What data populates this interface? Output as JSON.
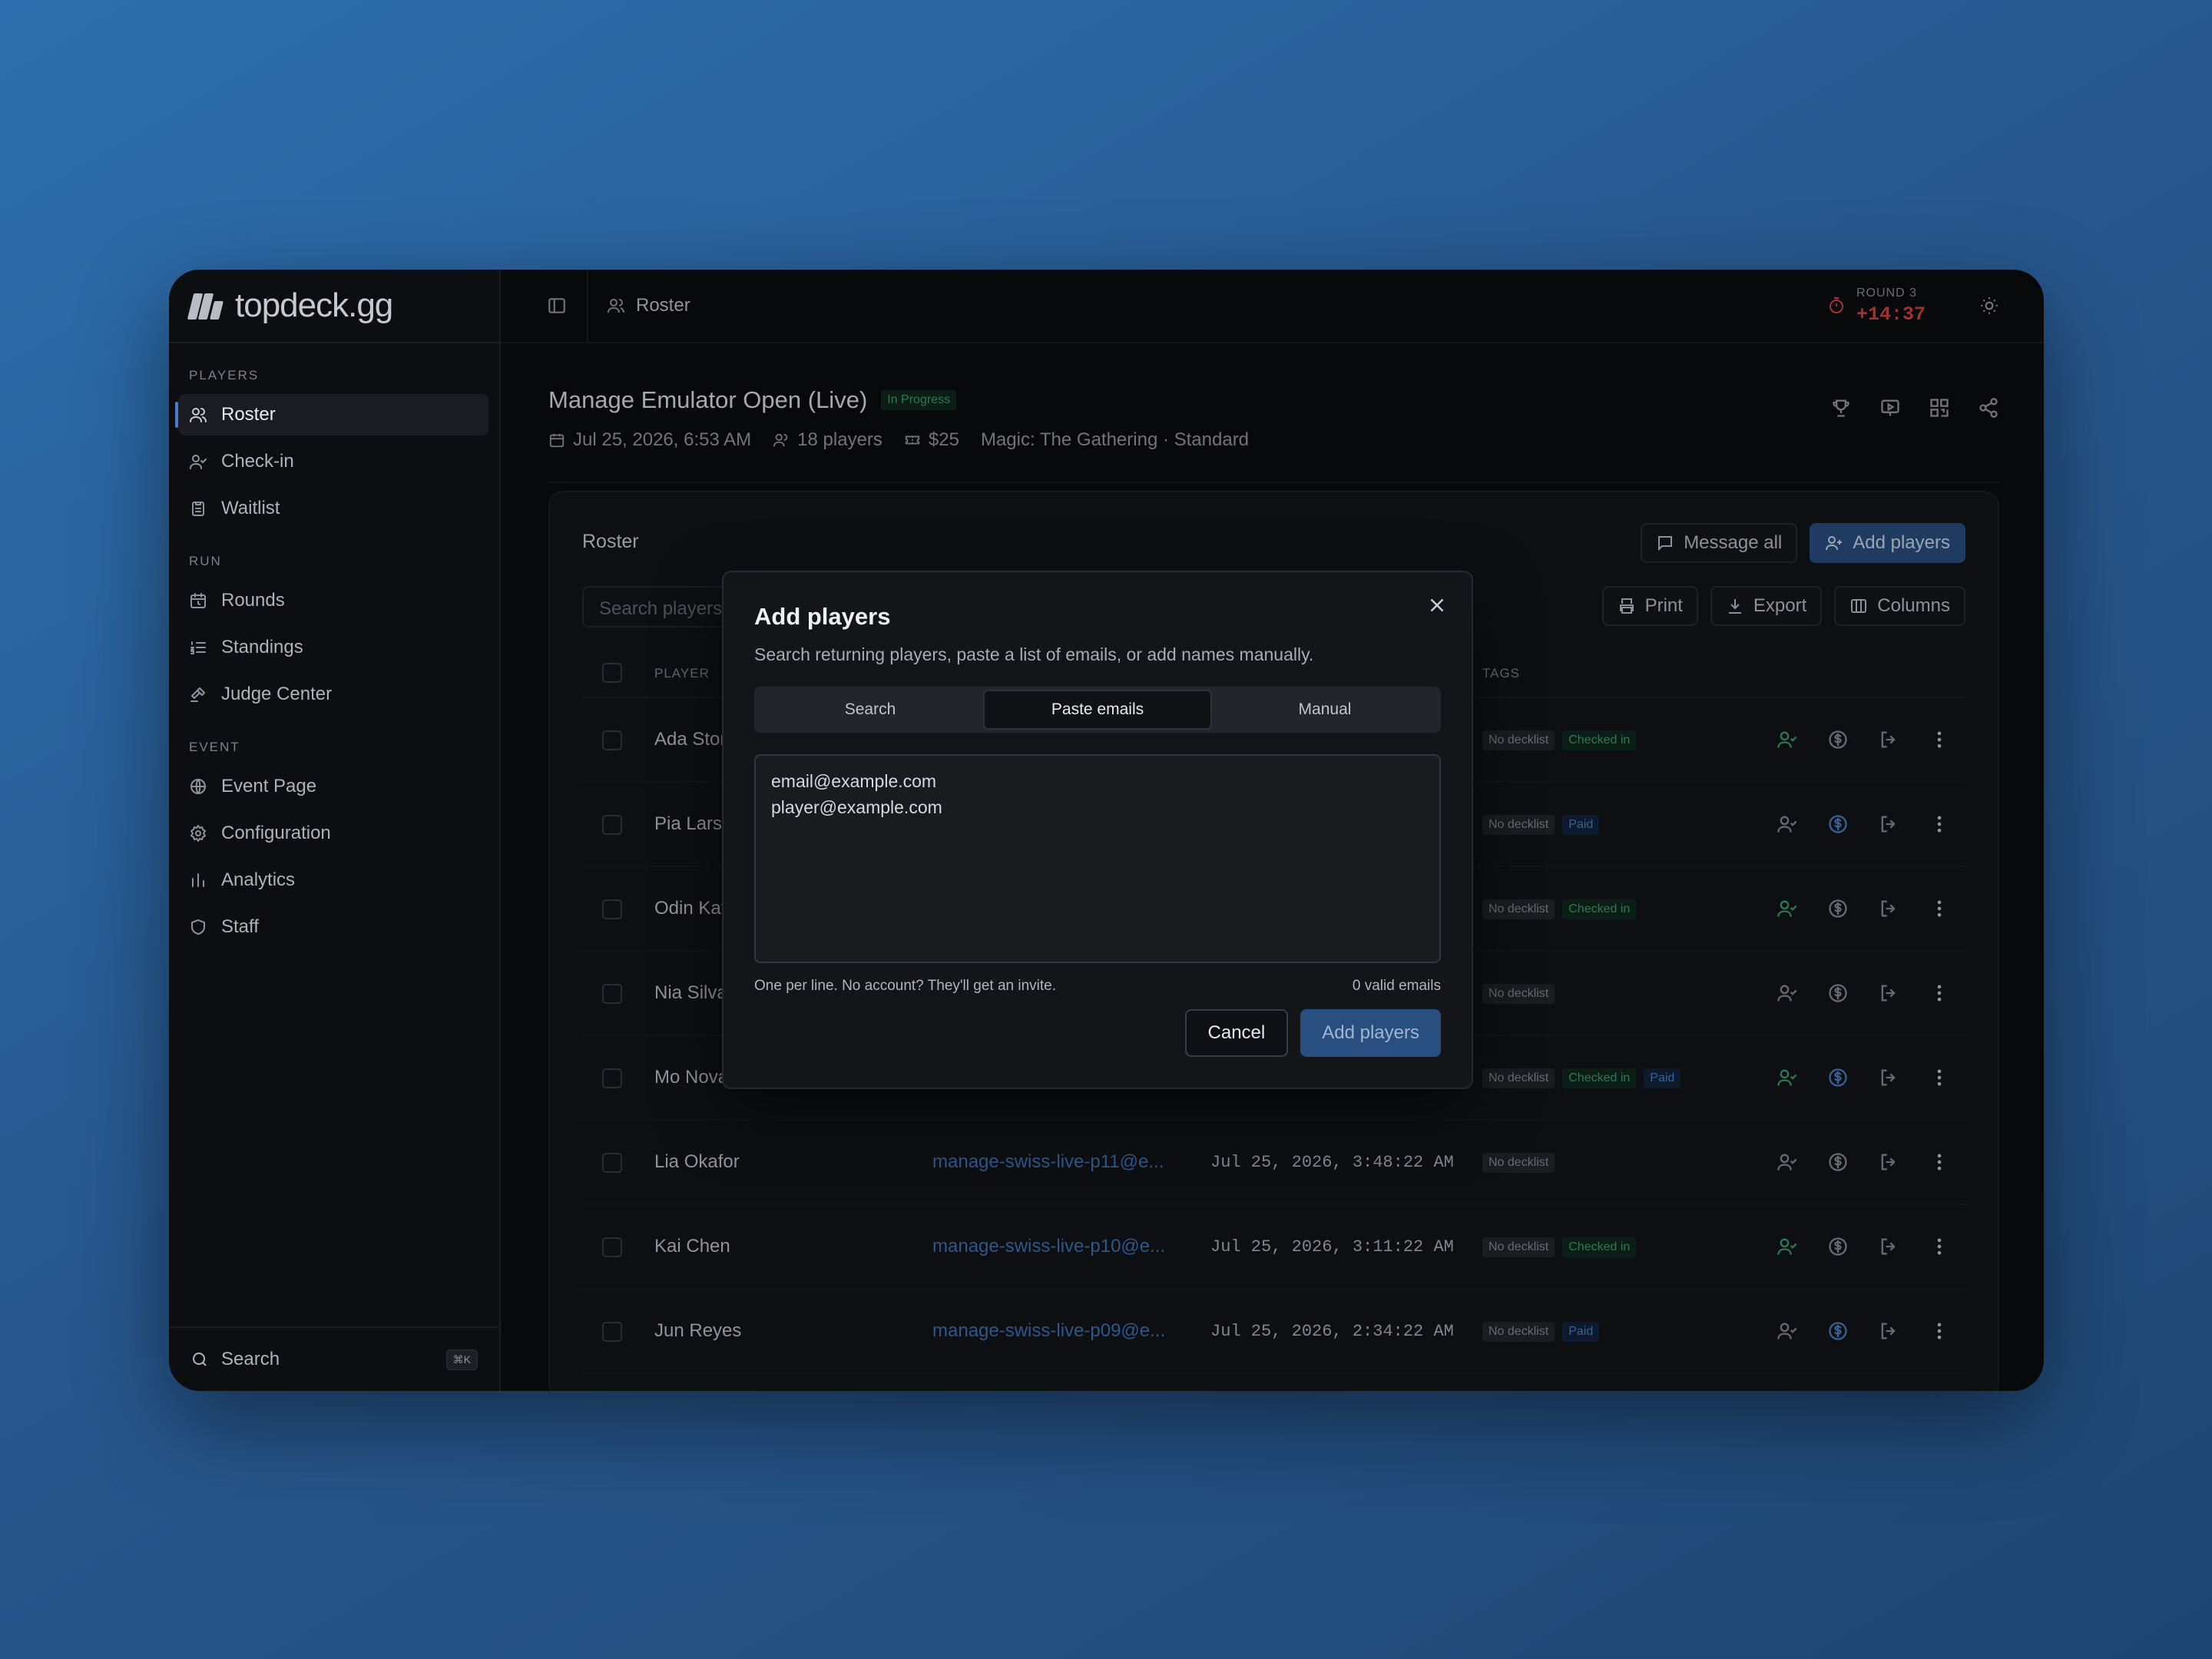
{
  "app": {
    "logo_text": "topdeck.gg"
  },
  "sidebar": {
    "sections": [
      {
        "title": "PLAYERS",
        "items": [
          {
            "label": "Roster",
            "icon": "users-icon",
            "active": true
          },
          {
            "label": "Check-in",
            "icon": "user-check-icon"
          },
          {
            "label": "Waitlist",
            "icon": "clipboard-icon"
          }
        ]
      },
      {
        "title": "RUN",
        "items": [
          {
            "label": "Rounds",
            "icon": "calendar-clock-icon"
          },
          {
            "label": "Standings",
            "icon": "list-ordered-icon"
          },
          {
            "label": "Judge Center",
            "icon": "gavel-icon"
          }
        ]
      },
      {
        "title": "EVENT",
        "items": [
          {
            "label": "Event Page",
            "icon": "globe-icon"
          },
          {
            "label": "Configuration",
            "icon": "gear-icon"
          },
          {
            "label": "Analytics",
            "icon": "bar-chart-icon"
          },
          {
            "label": "Staff",
            "icon": "shield-icon"
          }
        ]
      }
    ],
    "search": {
      "label": "Search",
      "shortcut": "⌘K"
    }
  },
  "topbar": {
    "breadcrumb": "Roster",
    "round_label": "ROUND 3",
    "round_timer": "+14:37"
  },
  "event": {
    "title": "Manage Emulator Open (Live)",
    "status": "In Progress",
    "date": "Jul 25, 2026, 6:53 AM",
    "players": "18  players",
    "fee": "$25",
    "format": "Magic: The Gathering · Standard"
  },
  "roster": {
    "title": "Roster",
    "message_all": "Message all",
    "add_players": "Add players",
    "print": "Print",
    "export": "Export",
    "columns": "Columns",
    "search_placeholder": "Search players",
    "col_player": "PLAYER",
    "col_tags": "TAGS",
    "rows": [
      {
        "name": "Ada Ston",
        "email": "",
        "date": "",
        "tags": [
          "No decklist",
          "Checked in"
        ],
        "checked": true,
        "paid": false
      },
      {
        "name": "Pia Larse",
        "email": "",
        "date": "",
        "tags": [
          "No decklist",
          "Paid"
        ],
        "checked": false,
        "paid": true
      },
      {
        "name": "Odin Kat",
        "email": "",
        "date": "",
        "tags": [
          "No decklist",
          "Checked in"
        ],
        "checked": true,
        "paid": false
      },
      {
        "name": "Nia Silva",
        "email": "",
        "date": "",
        "tags": [
          "No decklist"
        ],
        "checked": false,
        "paid": false
      },
      {
        "name": "Mo Novak",
        "email": "",
        "date": "",
        "tags": [
          "No decklist",
          "Checked in",
          "Paid"
        ],
        "checked": true,
        "paid": true
      },
      {
        "name": "Lia Okafor",
        "email": "manage-swiss-live-p11@e...",
        "date": "Jul 25, 2026, 3:48:22 AM",
        "tags": [
          "No decklist"
        ],
        "checked": false,
        "paid": false
      },
      {
        "name": "Kai Chen",
        "email": "manage-swiss-live-p10@e...",
        "date": "Jul 25, 2026, 3:11:22 AM",
        "tags": [
          "No decklist",
          "Checked in"
        ],
        "checked": true,
        "paid": false
      },
      {
        "name": "Jun Reyes",
        "email": "manage-swiss-live-p09@e...",
        "date": "Jul 25, 2026, 2:34:22 AM",
        "tags": [
          "No decklist",
          "Paid"
        ],
        "checked": false,
        "paid": true
      }
    ]
  },
  "modal": {
    "title": "Add players",
    "subtitle": "Search returning players, paste a list of emails, or add names manually.",
    "tabs": [
      "Search",
      "Paste emails",
      "Manual"
    ],
    "active_tab": 1,
    "textarea_value": "email@example.com\nplayer@example.com",
    "hint": "One per line. No account? They'll get an invite.",
    "count": "0 valid emails",
    "cancel": "Cancel",
    "submit": "Add players"
  },
  "colors": {
    "accent": "#2b5387",
    "green": "#3aa878",
    "red": "#e0434d",
    "link": "#3f78bf"
  }
}
